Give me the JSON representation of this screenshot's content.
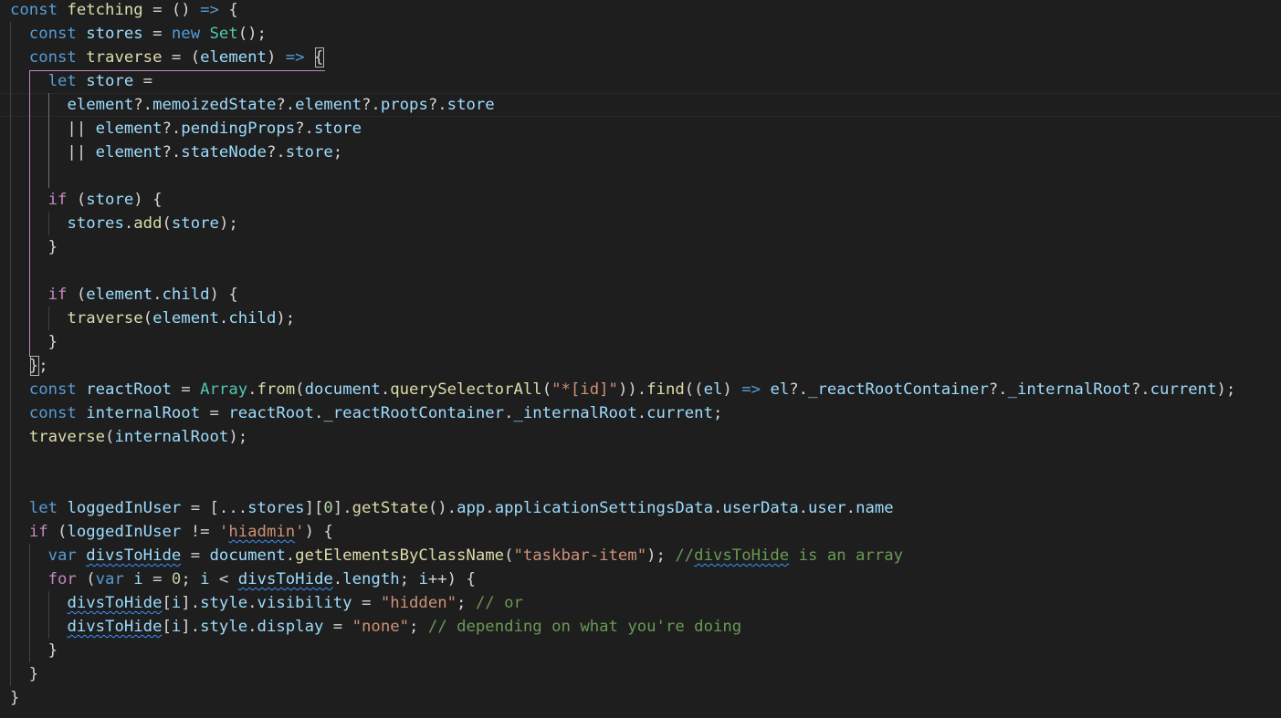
{
  "editor": {
    "lines": [
      [
        [
          "kw",
          "const"
        ],
        [
          "pun",
          " "
        ],
        [
          "fn",
          "fetching"
        ],
        [
          "pun",
          " = () "
        ],
        [
          "kw",
          "=>"
        ],
        [
          "pun",
          " {"
        ]
      ],
      [
        [
          "pun",
          "  "
        ],
        [
          "kw",
          "const"
        ],
        [
          "pun",
          " "
        ],
        [
          "var",
          "stores"
        ],
        [
          "pun",
          " = "
        ],
        [
          "kw",
          "new"
        ],
        [
          "pun",
          " "
        ],
        [
          "type",
          "Set"
        ],
        [
          "pun",
          "();"
        ]
      ],
      [
        [
          "pun",
          "  "
        ],
        [
          "kw",
          "const"
        ],
        [
          "pun",
          " "
        ],
        [
          "fn",
          "traverse"
        ],
        [
          "pun",
          " = ("
        ],
        [
          "var",
          "element"
        ],
        [
          "pun",
          ") "
        ],
        [
          "kw",
          "=>"
        ],
        [
          "pun",
          " {"
        ]
      ],
      [
        [
          "pun",
          "    "
        ],
        [
          "kw",
          "let"
        ],
        [
          "pun",
          " "
        ],
        [
          "var",
          "store"
        ],
        [
          "pun",
          " ="
        ]
      ],
      [
        [
          "pun",
          "      "
        ],
        [
          "var",
          "element"
        ],
        [
          "pun",
          "?."
        ],
        [
          "var",
          "memoizedState"
        ],
        [
          "pun",
          "?."
        ],
        [
          "var",
          "element"
        ],
        [
          "pun",
          "?."
        ],
        [
          "var",
          "props"
        ],
        [
          "pun",
          "?."
        ],
        [
          "var",
          "store"
        ]
      ],
      [
        [
          "pun",
          "      || "
        ],
        [
          "var",
          "element"
        ],
        [
          "pun",
          "?."
        ],
        [
          "var",
          "pendingProps"
        ],
        [
          "pun",
          "?."
        ],
        [
          "var",
          "store"
        ]
      ],
      [
        [
          "pun",
          "      || "
        ],
        [
          "var",
          "element"
        ],
        [
          "pun",
          "?."
        ],
        [
          "var",
          "stateNode"
        ],
        [
          "pun",
          "?."
        ],
        [
          "var",
          "store"
        ],
        [
          "pun",
          ";"
        ]
      ],
      [
        [
          "pun",
          ""
        ]
      ],
      [
        [
          "pun",
          "    "
        ],
        [
          "ctrl",
          "if"
        ],
        [
          "pun",
          " ("
        ],
        [
          "var",
          "store"
        ],
        [
          "pun",
          ") {"
        ]
      ],
      [
        [
          "pun",
          "      "
        ],
        [
          "var",
          "stores"
        ],
        [
          "pun",
          "."
        ],
        [
          "fn",
          "add"
        ],
        [
          "pun",
          "("
        ],
        [
          "var",
          "store"
        ],
        [
          "pun",
          ");"
        ]
      ],
      [
        [
          "pun",
          "    }"
        ]
      ],
      [
        [
          "pun",
          ""
        ]
      ],
      [
        [
          "pun",
          "    "
        ],
        [
          "ctrl",
          "if"
        ],
        [
          "pun",
          " ("
        ],
        [
          "var",
          "element"
        ],
        [
          "pun",
          "."
        ],
        [
          "var",
          "child"
        ],
        [
          "pun",
          ") {"
        ]
      ],
      [
        [
          "pun",
          "      "
        ],
        [
          "fn",
          "traverse"
        ],
        [
          "pun",
          "("
        ],
        [
          "var",
          "element"
        ],
        [
          "pun",
          "."
        ],
        [
          "var",
          "child"
        ],
        [
          "pun",
          ");"
        ]
      ],
      [
        [
          "pun",
          "    }"
        ]
      ],
      [
        [
          "pun",
          "  };"
        ]
      ],
      [
        [
          "pun",
          "  "
        ],
        [
          "kw",
          "const"
        ],
        [
          "pun",
          " "
        ],
        [
          "var",
          "reactRoot"
        ],
        [
          "pun",
          " = "
        ],
        [
          "type",
          "Array"
        ],
        [
          "pun",
          "."
        ],
        [
          "fn",
          "from"
        ],
        [
          "pun",
          "("
        ],
        [
          "var",
          "document"
        ],
        [
          "pun",
          "."
        ],
        [
          "fn",
          "querySelectorAll"
        ],
        [
          "pun",
          "("
        ],
        [
          "str",
          "\"*[id]\""
        ],
        [
          "pun",
          "))."
        ],
        [
          "fn",
          "find"
        ],
        [
          "pun",
          "(("
        ],
        [
          "var",
          "el"
        ],
        [
          "pun",
          ") "
        ],
        [
          "kw",
          "=>"
        ],
        [
          "pun",
          " "
        ],
        [
          "var",
          "el"
        ],
        [
          "pun",
          "?."
        ],
        [
          "var",
          "_reactRootContainer"
        ],
        [
          "pun",
          "?."
        ],
        [
          "var",
          "_internalRoot"
        ],
        [
          "pun",
          "?."
        ],
        [
          "var",
          "current"
        ],
        [
          "pun",
          ");"
        ]
      ],
      [
        [
          "pun",
          "  "
        ],
        [
          "kw",
          "const"
        ],
        [
          "pun",
          " "
        ],
        [
          "var",
          "internalRoot"
        ],
        [
          "pun",
          " = "
        ],
        [
          "var",
          "reactRoot"
        ],
        [
          "pun",
          "."
        ],
        [
          "var",
          "_reactRootContainer"
        ],
        [
          "pun",
          "."
        ],
        [
          "var",
          "_internalRoot"
        ],
        [
          "pun",
          "."
        ],
        [
          "var",
          "current"
        ],
        [
          "pun",
          ";"
        ]
      ],
      [
        [
          "pun",
          "  "
        ],
        [
          "fn",
          "traverse"
        ],
        [
          "pun",
          "("
        ],
        [
          "var",
          "internalRoot"
        ],
        [
          "pun",
          ");"
        ]
      ],
      [
        [
          "pun",
          ""
        ]
      ],
      [
        [
          "pun",
          ""
        ]
      ],
      [
        [
          "pun",
          "  "
        ],
        [
          "kw",
          "let"
        ],
        [
          "pun",
          " "
        ],
        [
          "var",
          "loggedInUser"
        ],
        [
          "pun",
          " = [..."
        ],
        [
          "var",
          "stores"
        ],
        [
          "pun",
          "]["
        ],
        [
          "num",
          "0"
        ],
        [
          "pun",
          "]."
        ],
        [
          "fn",
          "getState"
        ],
        [
          "pun",
          "()."
        ],
        [
          "var",
          "app"
        ],
        [
          "pun",
          "."
        ],
        [
          "var",
          "applicationSettingsData"
        ],
        [
          "pun",
          "."
        ],
        [
          "var",
          "userData"
        ],
        [
          "pun",
          "."
        ],
        [
          "var",
          "user"
        ],
        [
          "pun",
          "."
        ],
        [
          "var",
          "name"
        ]
      ],
      [
        [
          "pun",
          "  "
        ],
        [
          "ctrl",
          "if"
        ],
        [
          "pun",
          " ("
        ],
        [
          "var",
          "loggedInUser"
        ],
        [
          "pun",
          " != "
        ],
        [
          "str",
          "'"
        ],
        [
          "str squig",
          "hiadmin"
        ],
        [
          "str",
          "'"
        ],
        [
          "pun",
          ") {"
        ]
      ],
      [
        [
          "pun",
          "    "
        ],
        [
          "kw",
          "var"
        ],
        [
          "pun",
          " "
        ],
        [
          "var squig",
          "divsToHide"
        ],
        [
          "pun",
          " = "
        ],
        [
          "var",
          "document"
        ],
        [
          "pun",
          "."
        ],
        [
          "fn",
          "getElementsByClassName"
        ],
        [
          "pun",
          "("
        ],
        [
          "str",
          "\"taskbar-item\""
        ],
        [
          "pun",
          "); "
        ],
        [
          "cmt",
          "//"
        ],
        [
          "cmt squig",
          "divsToHide"
        ],
        [
          "cmt",
          " is an array"
        ]
      ],
      [
        [
          "pun",
          "    "
        ],
        [
          "ctrl",
          "for"
        ],
        [
          "pun",
          " ("
        ],
        [
          "kw",
          "var"
        ],
        [
          "pun",
          " "
        ],
        [
          "var",
          "i"
        ],
        [
          "pun",
          " = "
        ],
        [
          "num",
          "0"
        ],
        [
          "pun",
          "; "
        ],
        [
          "var",
          "i"
        ],
        [
          "pun",
          " < "
        ],
        [
          "var squig",
          "divsToHide"
        ],
        [
          "pun",
          "."
        ],
        [
          "var",
          "length"
        ],
        [
          "pun",
          "; "
        ],
        [
          "var",
          "i"
        ],
        [
          "pun",
          "++) {"
        ]
      ],
      [
        [
          "pun",
          "      "
        ],
        [
          "var squig",
          "divsToHide"
        ],
        [
          "pun",
          "["
        ],
        [
          "var",
          "i"
        ],
        [
          "pun",
          "]."
        ],
        [
          "var",
          "style"
        ],
        [
          "pun",
          "."
        ],
        [
          "var",
          "visibility"
        ],
        [
          "pun",
          " = "
        ],
        [
          "str",
          "\"hidden\""
        ],
        [
          "pun",
          "; "
        ],
        [
          "cmt",
          "// or"
        ]
      ],
      [
        [
          "pun",
          "      "
        ],
        [
          "var squig",
          "divsToHide"
        ],
        [
          "pun",
          "["
        ],
        [
          "var",
          "i"
        ],
        [
          "pun",
          "]."
        ],
        [
          "var",
          "style"
        ],
        [
          "pun",
          "."
        ],
        [
          "var",
          "display"
        ],
        [
          "pun",
          " = "
        ],
        [
          "str",
          "\"none\""
        ],
        [
          "pun",
          "; "
        ],
        [
          "cmt",
          "// depending on what you're doing"
        ]
      ],
      [
        [
          "pun",
          "    }"
        ]
      ],
      [
        [
          "pun",
          "  }"
        ]
      ],
      [
        [
          "pun",
          "}"
        ]
      ]
    ]
  }
}
